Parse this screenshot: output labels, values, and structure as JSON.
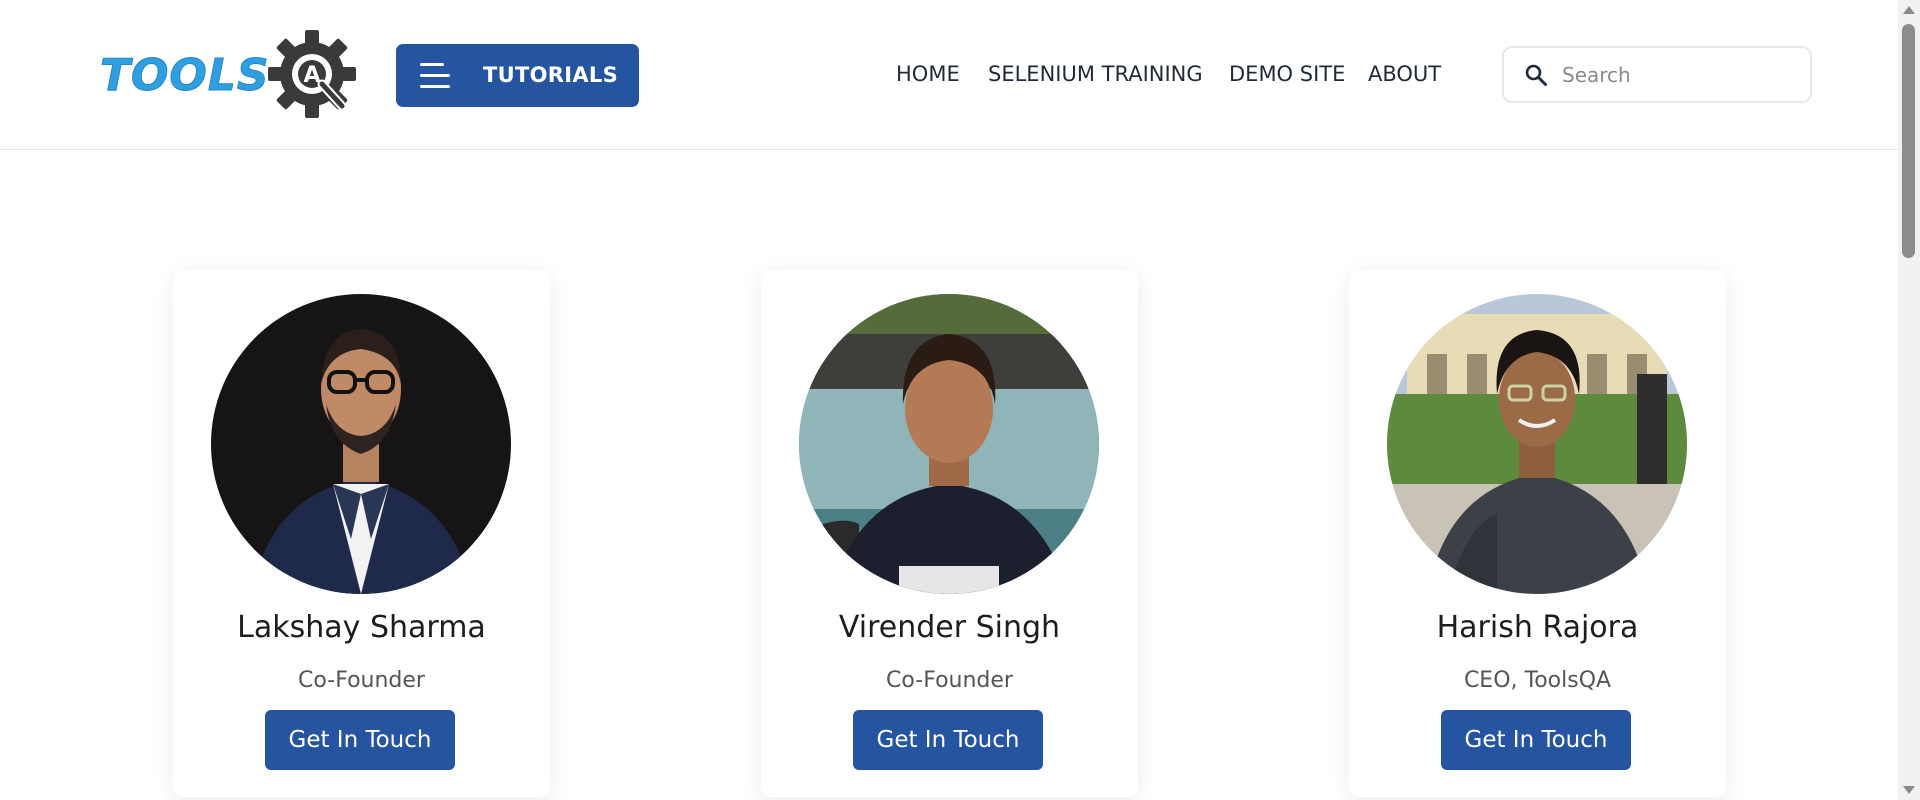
{
  "header": {
    "logo_text": "TOOLS",
    "logo_gear_letter": "A",
    "tutorials_label": "TUTORIALS",
    "nav": [
      {
        "label": "HOME"
      },
      {
        "label": "SELENIUM TRAINING"
      },
      {
        "label": "DEMO SITE"
      },
      {
        "label": "ABOUT"
      }
    ],
    "search_placeholder": "Search"
  },
  "team": [
    {
      "name": "Lakshay Sharma",
      "role": "Co-Founder",
      "button": "Get In Touch"
    },
    {
      "name": "Virender Singh",
      "role": "Co-Founder",
      "button": "Get In Touch"
    },
    {
      "name": "Harish Rajora",
      "role": "CEO, ToolsQA",
      "button": "Get In Touch"
    }
  ],
  "colors": {
    "brand_blue": "#2554a0",
    "logo_blue": "#2e9fe0",
    "gear_dark": "#3a3a3a"
  },
  "icons": [
    "hamburger-icon",
    "search-icon",
    "gear-icon"
  ]
}
